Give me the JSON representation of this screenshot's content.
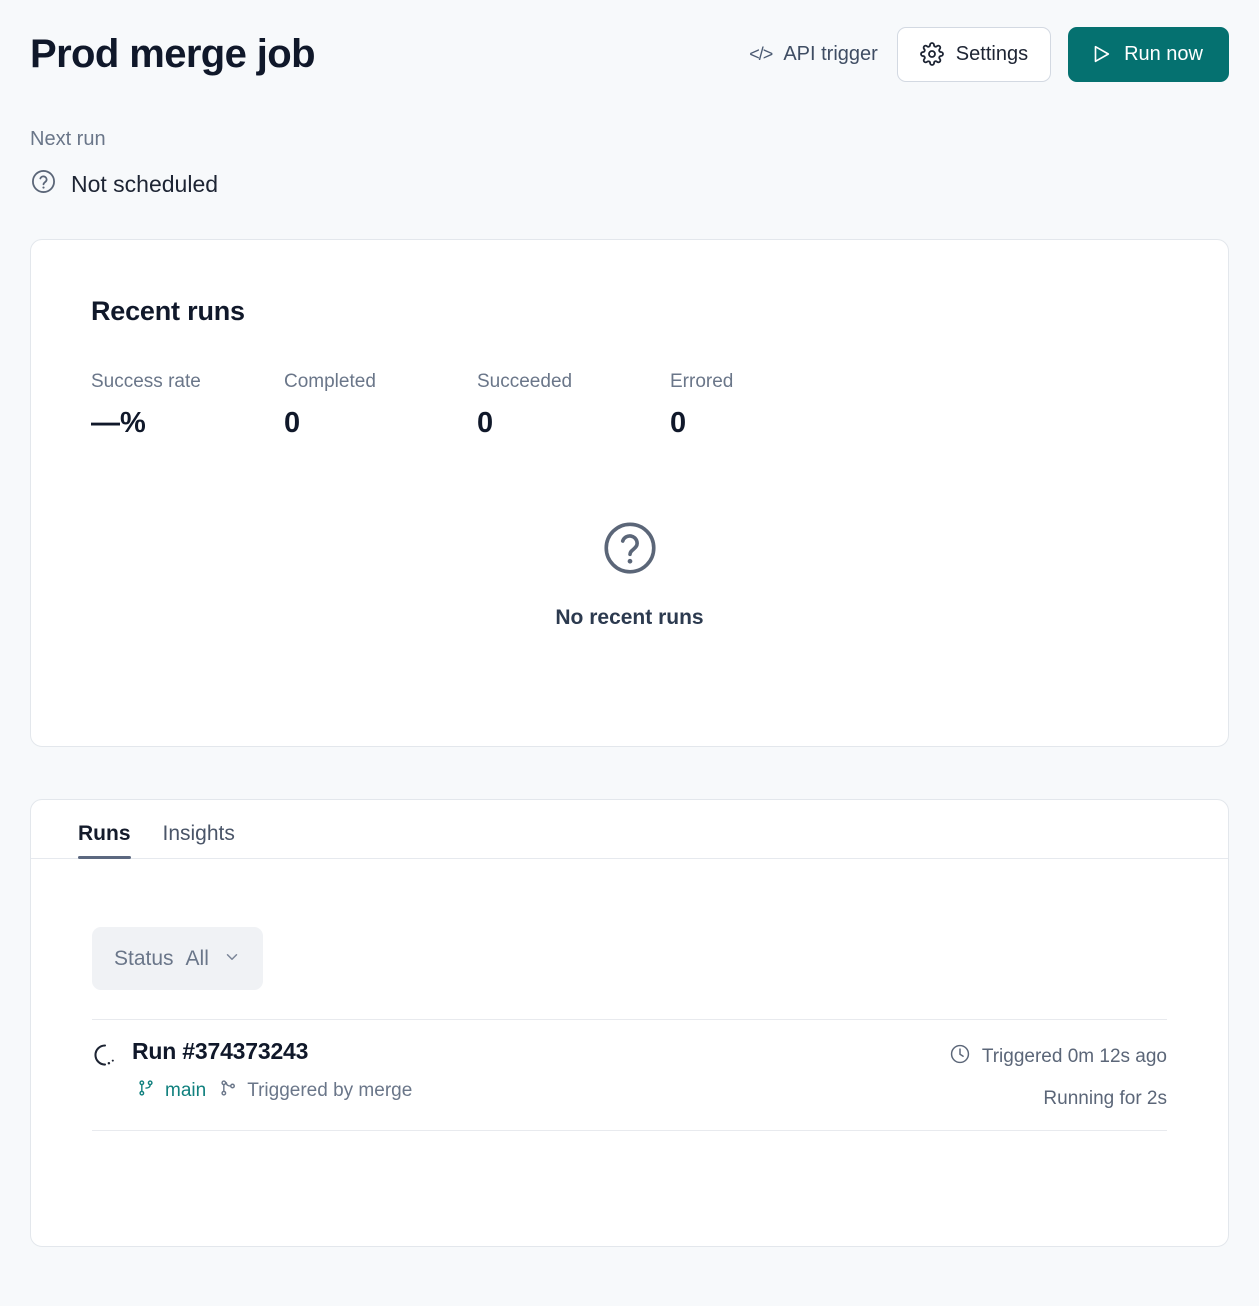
{
  "header": {
    "title": "Prod merge job",
    "api_trigger_label": "API trigger",
    "api_trigger_icon": "code-icon",
    "settings_label": "Settings",
    "settings_icon": "gear-icon",
    "run_now_label": "Run now",
    "run_now_icon": "play-icon",
    "accent_color": "#057170"
  },
  "next_run": {
    "label": "Next run",
    "value": "Not scheduled",
    "icon": "question-circle-icon"
  },
  "recent_runs": {
    "title": "Recent runs",
    "stats": [
      {
        "label": "Success rate",
        "value": "—%"
      },
      {
        "label": "Completed",
        "value": "0"
      },
      {
        "label": "Succeeded",
        "value": "0"
      },
      {
        "label": "Errored",
        "value": "0"
      }
    ],
    "empty_icon": "question-circle-icon",
    "empty_text": "No recent runs"
  },
  "tabs": [
    {
      "label": "Runs",
      "active": true
    },
    {
      "label": "Insights",
      "active": false
    }
  ],
  "filter": {
    "label": "Status",
    "value": "All",
    "chevron": "chevron-down-icon"
  },
  "runs": [
    {
      "status_icon": "loading-spinner-icon",
      "title": "Run #374373243",
      "branch_icon": "git-branch-icon",
      "branch": "main",
      "trigger_icon": "git-merge-icon",
      "trigger": "Triggered by merge",
      "clock_icon": "clock-icon",
      "triggered_ago": "Triggered 0m 12s ago",
      "duration": "Running for 2s",
      "branch_color": "#10807e"
    }
  ]
}
